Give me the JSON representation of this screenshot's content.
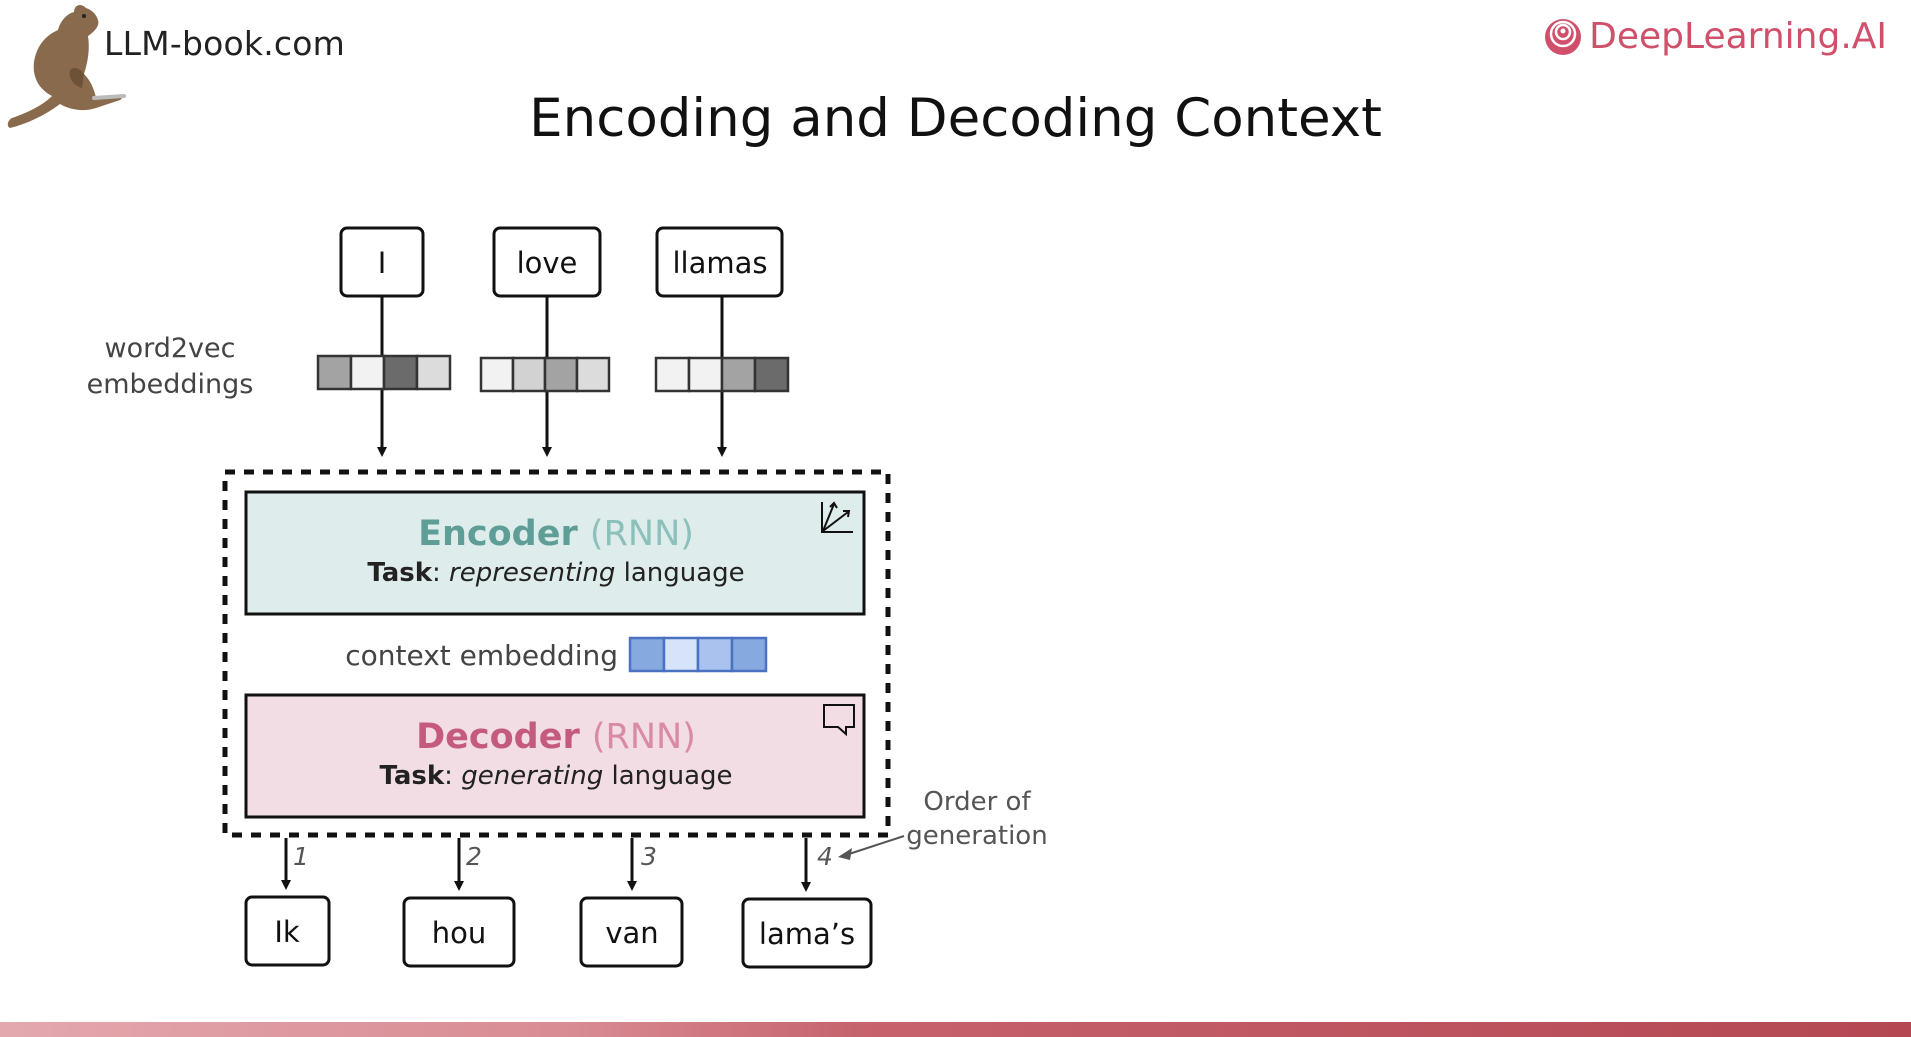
{
  "header": {
    "site": "LLM-book.com",
    "brand": "DeepLearning.AI",
    "title": "Encoding and Decoding Context"
  },
  "diagram": {
    "embeddings_label_line1": "word2vec",
    "embeddings_label_line2": "embeddings",
    "inputs": [
      "I",
      "love",
      "llamas"
    ],
    "encoder": {
      "name": "Encoder",
      "model": "(RNN)",
      "task_label": "Task",
      "task_verb": "representing",
      "task_object": "language"
    },
    "context_label": "context embedding",
    "decoder": {
      "name": "Decoder",
      "model": "(RNN)",
      "task_label": "Task",
      "task_verb": "generating",
      "task_object": "language"
    },
    "outputs": [
      "Ik",
      "hou",
      "van",
      "lama’s"
    ],
    "steps": [
      "1",
      "2",
      "3",
      "4"
    ],
    "order_note_line1": "Order of",
    "order_note_line2": "generation"
  },
  "colors": {
    "encoder_fill": "#deeceb",
    "encoder_text": "#5e9e97",
    "decoder_fill": "#f1dde3",
    "decoder_text": "#c45a7e",
    "context_blue": "#86a9e0",
    "brand": "#d0506b"
  }
}
